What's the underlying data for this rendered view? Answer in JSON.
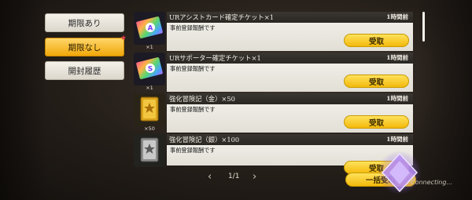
{
  "tabs": [
    {
      "label": "期限あり",
      "active": false
    },
    {
      "label": "期限なし",
      "active": true
    },
    {
      "label": "開封履歴",
      "active": false
    }
  ],
  "items": [
    {
      "title": "URアシストカード確定チケット×1",
      "time": "1時間前",
      "desc": "事前登録報酬です",
      "button": "受取",
      "qty": "×1",
      "icon": "ur-assist-ticket-icon"
    },
    {
      "title": "URサポーター確定チケット×1",
      "time": "1時間前",
      "desc": "事前登録報酬です",
      "button": "受取",
      "qty": "×1",
      "icon": "ur-supporter-ticket-icon"
    },
    {
      "title": "強化冒険記（金）×50",
      "time": "1時間前",
      "desc": "事前登録報酬です",
      "button": "受取",
      "qty": "×50",
      "icon": "gold-adventure-book-icon"
    },
    {
      "title": "強化冒険記（銀）×100",
      "time": "1時間前",
      "desc": "事前登録報酬です",
      "button": "受取",
      "qty": "",
      "icon": "silver-adventure-book-icon"
    }
  ],
  "pager": {
    "text": "1/1"
  },
  "bulk_button": "一括受取",
  "connecting": "Connecting..."
}
